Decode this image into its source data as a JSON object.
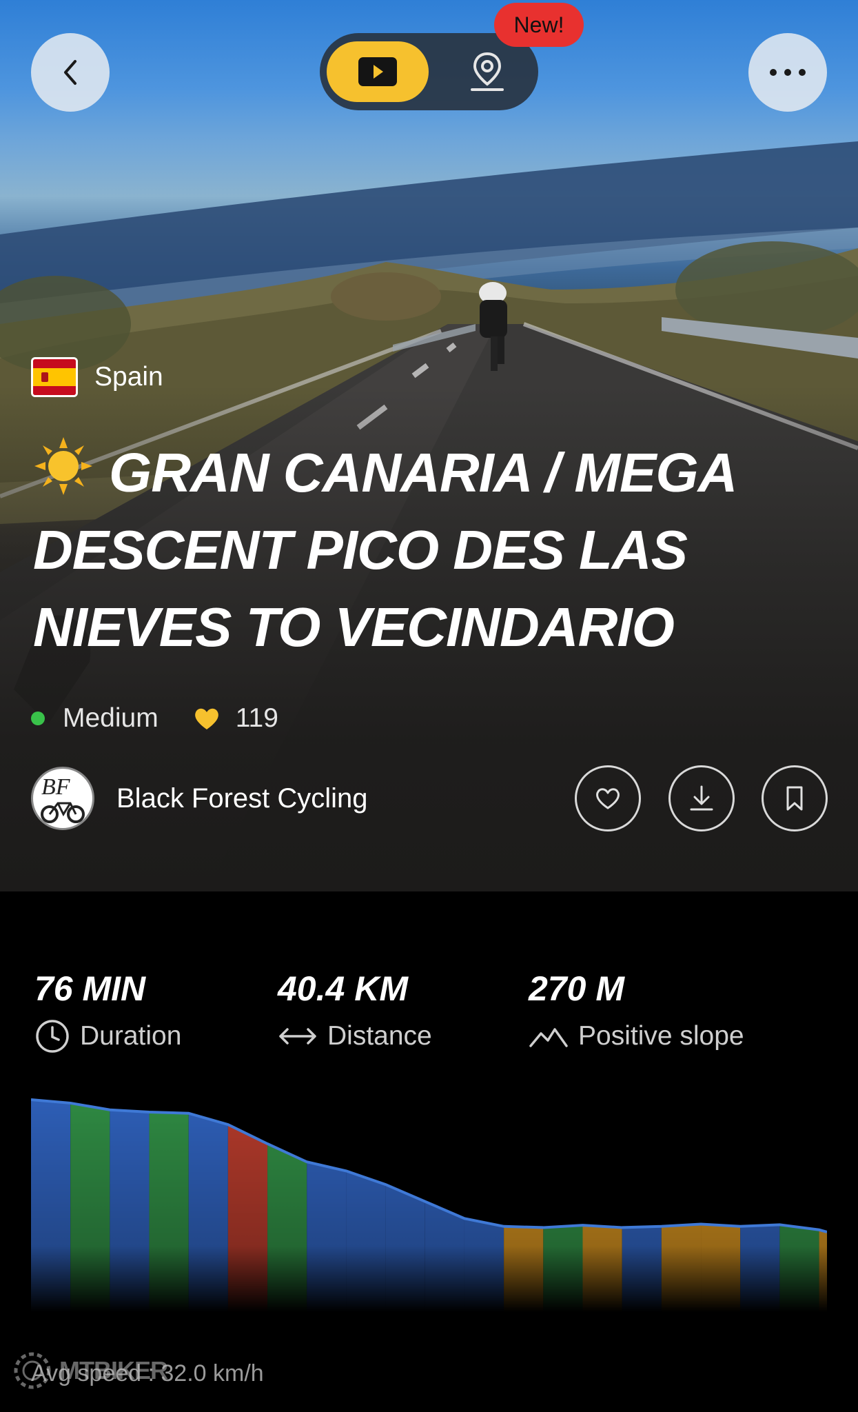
{
  "toggle": {
    "new_badge": "New!"
  },
  "route": {
    "country": "Spain",
    "title": "GRAN CANARIA / MEGA DESCENT PICO DES LAS NIEVES TO VECINDARIO",
    "level": "Medium",
    "likes": "119",
    "author": "Black  Forest Cycling",
    "avatar_initials": "BF"
  },
  "stats": [
    {
      "value": "76 MIN",
      "label": "Duration",
      "icon": "clock-icon"
    },
    {
      "value": "40.4 KM",
      "label": "Distance",
      "icon": "distance-arrows-icon"
    },
    {
      "value": "270 M",
      "label": "Positive slope",
      "icon": "mountain-icon"
    }
  ],
  "footer": {
    "avg_speed": "Avg speed : 32.0 km/h",
    "watermark": "MTBIKER"
  },
  "colors": {
    "accent": "#f6c12e",
    "new_badge": "#e8312f",
    "level_medium": "#39c24a",
    "slope_flat": "#2e5fb8",
    "slope_low": "#2f8a43",
    "slope_mid": "#c98a1e",
    "slope_steep": "#b23a2b"
  },
  "chart_data": {
    "type": "area",
    "x": [
      0,
      2,
      4,
      6,
      8,
      10,
      12,
      14,
      16,
      18,
      20,
      22,
      24,
      26,
      28,
      30,
      32,
      34,
      36,
      38,
      40,
      40.4
    ],
    "elevation": [
      1950,
      1920,
      1860,
      1840,
      1830,
      1730,
      1560,
      1400,
      1320,
      1200,
      1050,
      900,
      830,
      820,
      840,
      820,
      830,
      850,
      830,
      845,
      800,
      780
    ],
    "slope_class_segments": [
      "flat",
      "low",
      "flat",
      "low",
      "flat",
      "steep",
      "low",
      "flat",
      "flat",
      "flat",
      "flat",
      "flat",
      "mid",
      "low",
      "mid",
      "flat",
      "mid",
      "mid",
      "flat",
      "low",
      "mid",
      "flat"
    ]
  }
}
